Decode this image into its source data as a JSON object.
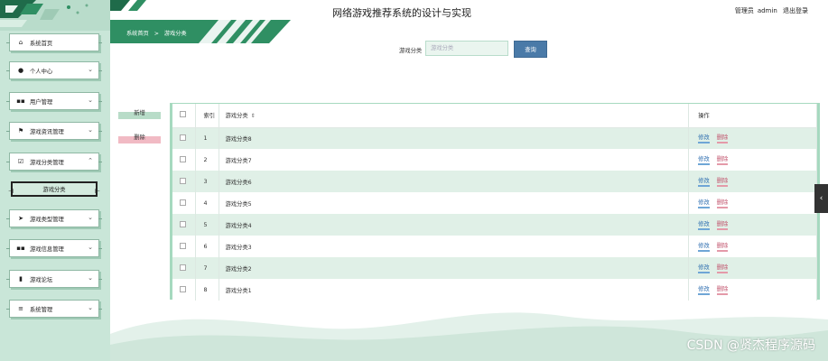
{
  "header": {
    "title": "网络游戏推荐系统的设计与实现",
    "user_role": "管理员",
    "username": "admin",
    "logout_label": "退出登录"
  },
  "breadcrumb": {
    "home": "系统首页",
    "separator": ">",
    "current": "游戏分类"
  },
  "sidebar": {
    "items": [
      {
        "label": "系统首页",
        "icon": "home-icon",
        "expandable": false
      },
      {
        "label": "个人中心",
        "icon": "user-icon",
        "expandable": true
      },
      {
        "label": "用户管理",
        "icon": "grid-icon",
        "expandable": true
      },
      {
        "label": "游戏资讯管理",
        "icon": "flag-icon",
        "expandable": true
      },
      {
        "label": "游戏分类管理",
        "icon": "checkbox-icon",
        "expandable": true,
        "expanded": true
      },
      {
        "label": "游戏类型管理",
        "icon": "send-icon",
        "expandable": true
      },
      {
        "label": "游戏信息管理",
        "icon": "grid-icon",
        "expandable": true
      },
      {
        "label": "游戏论坛",
        "icon": "bar-chart-icon",
        "expandable": true
      },
      {
        "label": "系统管理",
        "icon": "menu-icon",
        "expandable": true
      }
    ],
    "active_sub_item": "游戏分类"
  },
  "search": {
    "label": "游戏分类",
    "placeholder": "游戏分类",
    "value": "",
    "button_label": "查询"
  },
  "actions": {
    "add_label": "新增",
    "delete_label": "删除"
  },
  "table": {
    "headers": {
      "index": "索引",
      "category": "游戏分类",
      "operations": "操作"
    },
    "sort_icon": "⇕",
    "edit_label": "修改",
    "delete_label": "删除",
    "rows": [
      {
        "index": "1",
        "category": "游戏分类8"
      },
      {
        "index": "2",
        "category": "游戏分类7"
      },
      {
        "index": "3",
        "category": "游戏分类6"
      },
      {
        "index": "4",
        "category": "游戏分类5"
      },
      {
        "index": "5",
        "category": "游戏分类4"
      },
      {
        "index": "6",
        "category": "游戏分类3"
      },
      {
        "index": "7",
        "category": "游戏分类2"
      },
      {
        "index": "8",
        "category": "游戏分类1"
      }
    ]
  },
  "watermark": "CSDN @贤杰程序源码",
  "colors": {
    "sidebar_bg": "#c9e6d8",
    "accent_green": "#2f8f63",
    "table_stripe": "#e0f0e7",
    "search_button": "#4a7aa8",
    "add_button": "#b8dcc8",
    "delete_button": "#f1bac4",
    "edit_link": "#2f6fb0",
    "delete_link": "#c0506a"
  }
}
